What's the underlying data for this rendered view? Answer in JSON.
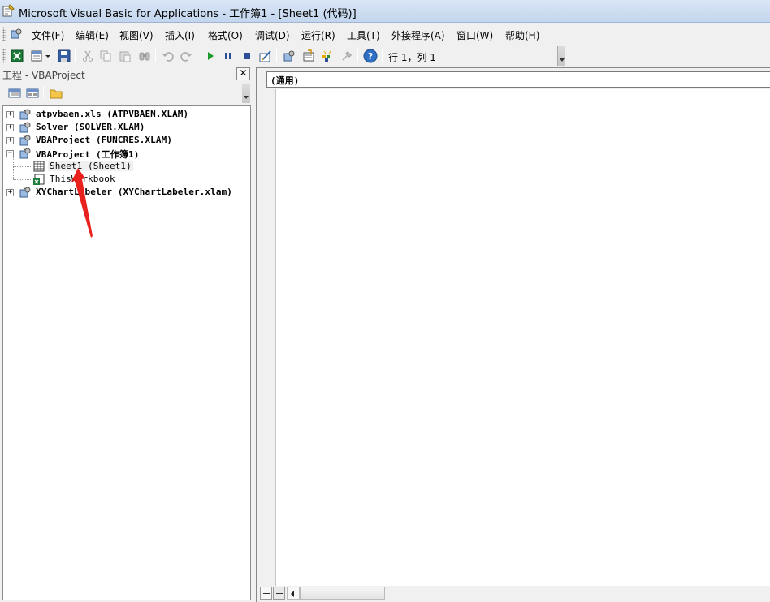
{
  "window": {
    "title": "Microsoft Visual Basic for Applications - 工作簿1 - [Sheet1 (代码)]"
  },
  "menu": [
    {
      "id": "file",
      "label": "文件(F)"
    },
    {
      "id": "edit",
      "label": "编辑(E)"
    },
    {
      "id": "view",
      "label": "视图(V)"
    },
    {
      "id": "insert",
      "label": "插入(I)"
    },
    {
      "id": "format",
      "label": "格式(O)"
    },
    {
      "id": "debug",
      "label": "调试(D)"
    },
    {
      "id": "run",
      "label": "运行(R)"
    },
    {
      "id": "tools",
      "label": "工具(T)"
    },
    {
      "id": "addins",
      "label": "外接程序(A)"
    },
    {
      "id": "window",
      "label": "窗口(W)"
    },
    {
      "id": "help",
      "label": "帮助(H)"
    }
  ],
  "toolbar": {
    "status": "行 1，列 1",
    "icons": [
      "excel-icon",
      "insert-module-icon",
      "save-icon",
      "cut-icon",
      "copy-icon",
      "paste-icon",
      "find-icon",
      "undo-icon",
      "redo-icon",
      "run-icon",
      "break-icon",
      "reset-icon",
      "design-mode-icon",
      "project-explorer-icon",
      "properties-icon",
      "object-browser-icon",
      "toolbox-icon",
      "help-icon"
    ]
  },
  "project_panel": {
    "title": "工程 - VBAProject",
    "close_label": "✕",
    "tree": [
      {
        "text": "atpvbaen.xls (ATPVBAEN.XLAM)",
        "expander": "+",
        "bold": true
      },
      {
        "text": "Solver (SOLVER.XLAM)",
        "expander": "+",
        "bold": true
      },
      {
        "text": "VBAProject (FUNCRES.XLAM)",
        "expander": "+",
        "bold": true
      },
      {
        "text": "VBAProject (工作簿1)",
        "expander": "−",
        "bold": true
      },
      {
        "text": "Sheet1 (Sheet1)",
        "expander": "",
        "bold": false,
        "selected": true
      },
      {
        "text": "ThisWorkbook",
        "expander": "",
        "bold": false
      },
      {
        "text": "XYChartLabeler (XYChartLabeler.xlam)",
        "expander": "+",
        "bold": true
      }
    ]
  },
  "code_window": {
    "object_combo": "(通用)",
    "code_text": ""
  },
  "colors": {
    "annotation_arrow": "#e8211d",
    "titlebar": "#c9daf0"
  }
}
